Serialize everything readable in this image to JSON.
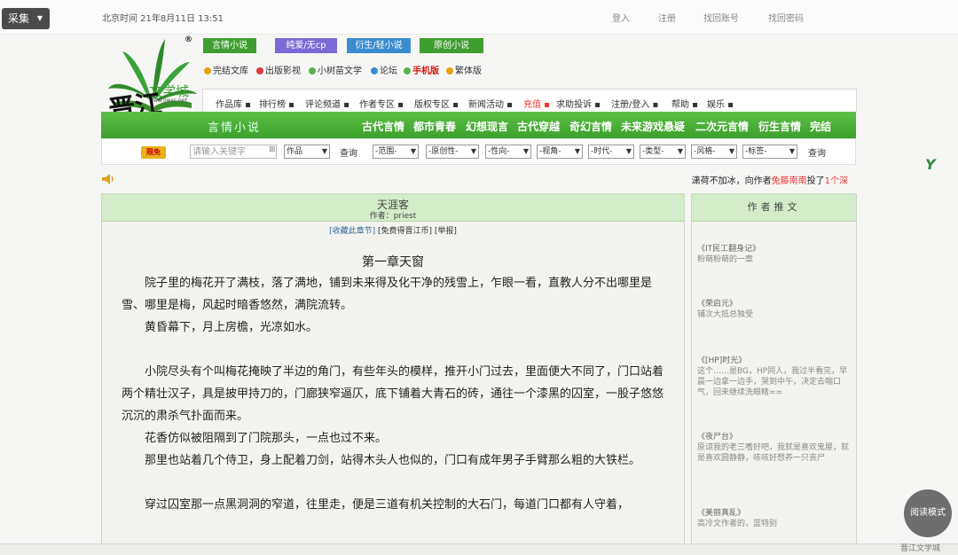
{
  "topbar": {
    "collect_label": "采集",
    "beijing_time": "北京时间 21年8月11日 13:51",
    "links": [
      "登入",
      "注册",
      "找回账号",
      "找回密码"
    ]
  },
  "logo": {
    "brand": "文学城",
    "site": "www.jjwxc.net",
    "reg": "®",
    "script": "晋江"
  },
  "categories": [
    {
      "label": "言情小说",
      "color": "#3e9e2f"
    },
    {
      "label": "纯爱/无cp",
      "color": "#7a6bd6"
    },
    {
      "label": "衍生/轻小说",
      "color": "#3a8ccf"
    },
    {
      "label": "原创小说",
      "color": "#3e9e2f"
    }
  ],
  "subcats": [
    {
      "label": "完结文库",
      "color": "#e8a010",
      "red": false
    },
    {
      "label": "出版影视",
      "color": "#e23a3a",
      "red": false
    },
    {
      "label": "小树苗文学",
      "color": "#59b34a",
      "red": false
    },
    {
      "label": "论坛",
      "color": "#3a8ccf",
      "red": false
    },
    {
      "label": "手机版",
      "color": "#59b34a",
      "red": true
    },
    {
      "label": "繁体版",
      "color": "#e8a010",
      "red": false
    }
  ],
  "nav": [
    "作品库",
    "排行榜",
    "评论频道",
    "作者专区",
    "版权专区",
    "新闻活动",
    "充值",
    "求助投诉",
    "注册/登入",
    "帮助",
    "娱乐"
  ],
  "greenbar": {
    "title": "言情小说",
    "links": [
      "古代言情",
      "都市青春",
      "幻想现言",
      "古代穿越",
      "奇幻言情",
      "未来游戏悬疑",
      "二次元言情",
      "衍生言情",
      "完结"
    ]
  },
  "search": {
    "free_badge": "限免",
    "placeholder": "请输入关键字",
    "type_select": "作品",
    "query_btn": "查询",
    "filters": [
      "-范围-",
      "-原创性-",
      "-性向-",
      "-视角-",
      "-时代-",
      "-类型-",
      "-风格-",
      "-标签-"
    ],
    "query_btn2": "查询"
  },
  "slogan": {
    "prefix": "潇荷不加冰，向作者",
    "author": "兔藤南南",
    "mid": "投了",
    "count": "1个深"
  },
  "book": {
    "title": "天涯客",
    "author": "作者：priest",
    "actions_collect": "[收藏此章节]",
    "actions_rest": " [免费得晋江币] [举报]",
    "chapter_title": "第一章天窗",
    "paragraphs": [
      {
        "text": "院子里的梅花开了满枝，落了满地，铺到未来得及化干净的残雪上，乍眼一看，直教人分不出哪里是雪、哪里是梅，风起时暗香悠然，满院流转。",
        "gap": false
      },
      {
        "text": "黄昏幕下，月上房檐，光凉如水。",
        "gap": false
      },
      {
        "text": "小院尽头有个叫梅花掩映了半边的角门，有些年头的模样，推开小门过去，里面便大不同了，门口站着两个精壮汉子，具是披甲持刀的，门廊狭窄逼仄，底下铺着大青石的砖，通往一个漆黑的囚室，一股子悠悠沉沉的肃杀气扑面而来。",
        "gap": true
      },
      {
        "text": "花香仿似被阻隔到了门院那头，一点也过不来。",
        "gap": false
      },
      {
        "text": "那里也站着几个侍卫，身上配着刀剑，站得木头人也似的，门口有成年男子手臂那么粗的大铁栏。",
        "gap": false
      },
      {
        "text": "穿过囚室那一点黑洞洞的窄道，往里走，便是三道有机关控制的大石门，每道门口都有人守着，",
        "gap": true
      }
    ]
  },
  "sidebar": {
    "title": "作者推文",
    "recs": [
      {
        "title": "《IT民工翻身记》",
        "desc": "粉萌粉萌的一章"
      },
      {
        "title": "《荣启元》",
        "desc": "铺次大抵总独受"
      },
      {
        "title": "《[HP]时光》",
        "desc": "这个……是BG，HP同人，我过半看完，早晨一边拿一边手，哭到中午，决定去喘口气，回来继续洗眼睛=="
      },
      {
        "title": "《夜尸台》",
        "desc": "原谅我的老三嗜好吧，我就是喜欢鬼屋，就是喜欢圆静静，咳咳好想养一只丧尸"
      },
      {
        "title": "《美丽真乱》",
        "desc": "高冷文作者的，蓝特别"
      }
    ]
  },
  "ylogo": "Y",
  "readmode": "阅读模式",
  "footer_text": "晋江文学城"
}
